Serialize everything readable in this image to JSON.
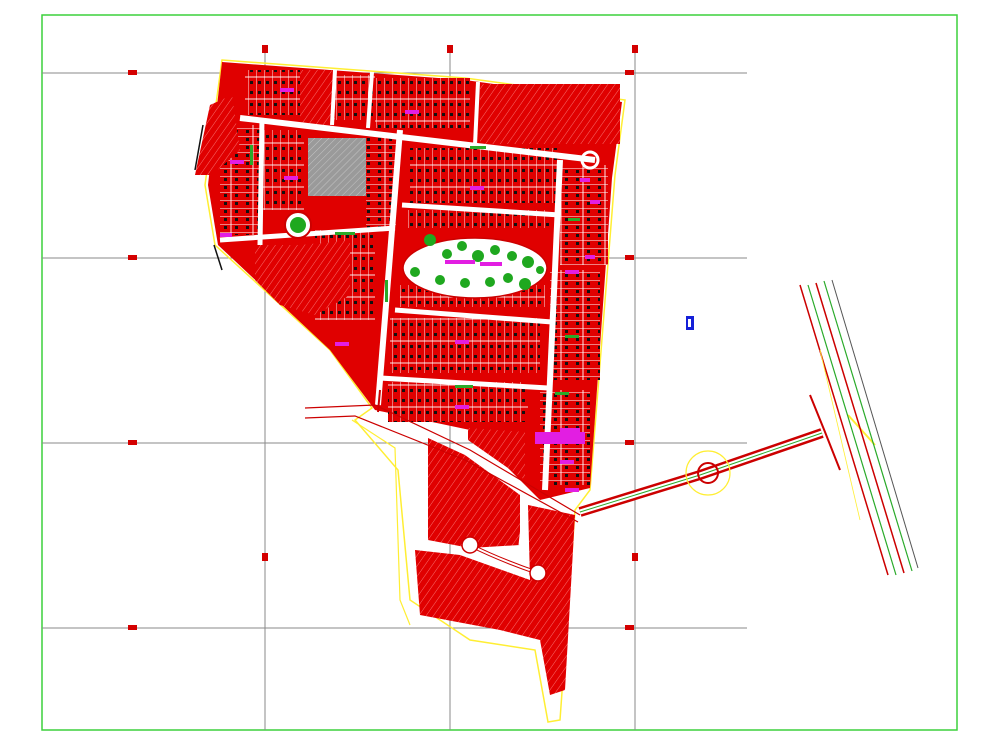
{
  "drawing": {
    "title": "",
    "type": "cad-site-plan",
    "colors": {
      "background": "#ffffff",
      "sheet_border": "#3cd13c",
      "grid": "#8a8a8a",
      "grid_tick": "#d40000",
      "boundary": "#ffee33",
      "lot_fill": "#e00000",
      "lot_line": "#ffffff",
      "plaza_fill": "#9a9a9a",
      "tree": "#1fa81f",
      "accent_magenta": "#e21ee2",
      "accent_green": "#2aaa2a",
      "road_line": "#cc0000",
      "marker": "#1520d8"
    },
    "layers": [
      {
        "name": "sheet-border"
      },
      {
        "name": "coordinate-grid"
      },
      {
        "name": "site-boundary"
      },
      {
        "name": "lots-blocks"
      },
      {
        "name": "roads"
      },
      {
        "name": "park-trees"
      },
      {
        "name": "access-road"
      },
      {
        "name": "highway"
      }
    ]
  }
}
